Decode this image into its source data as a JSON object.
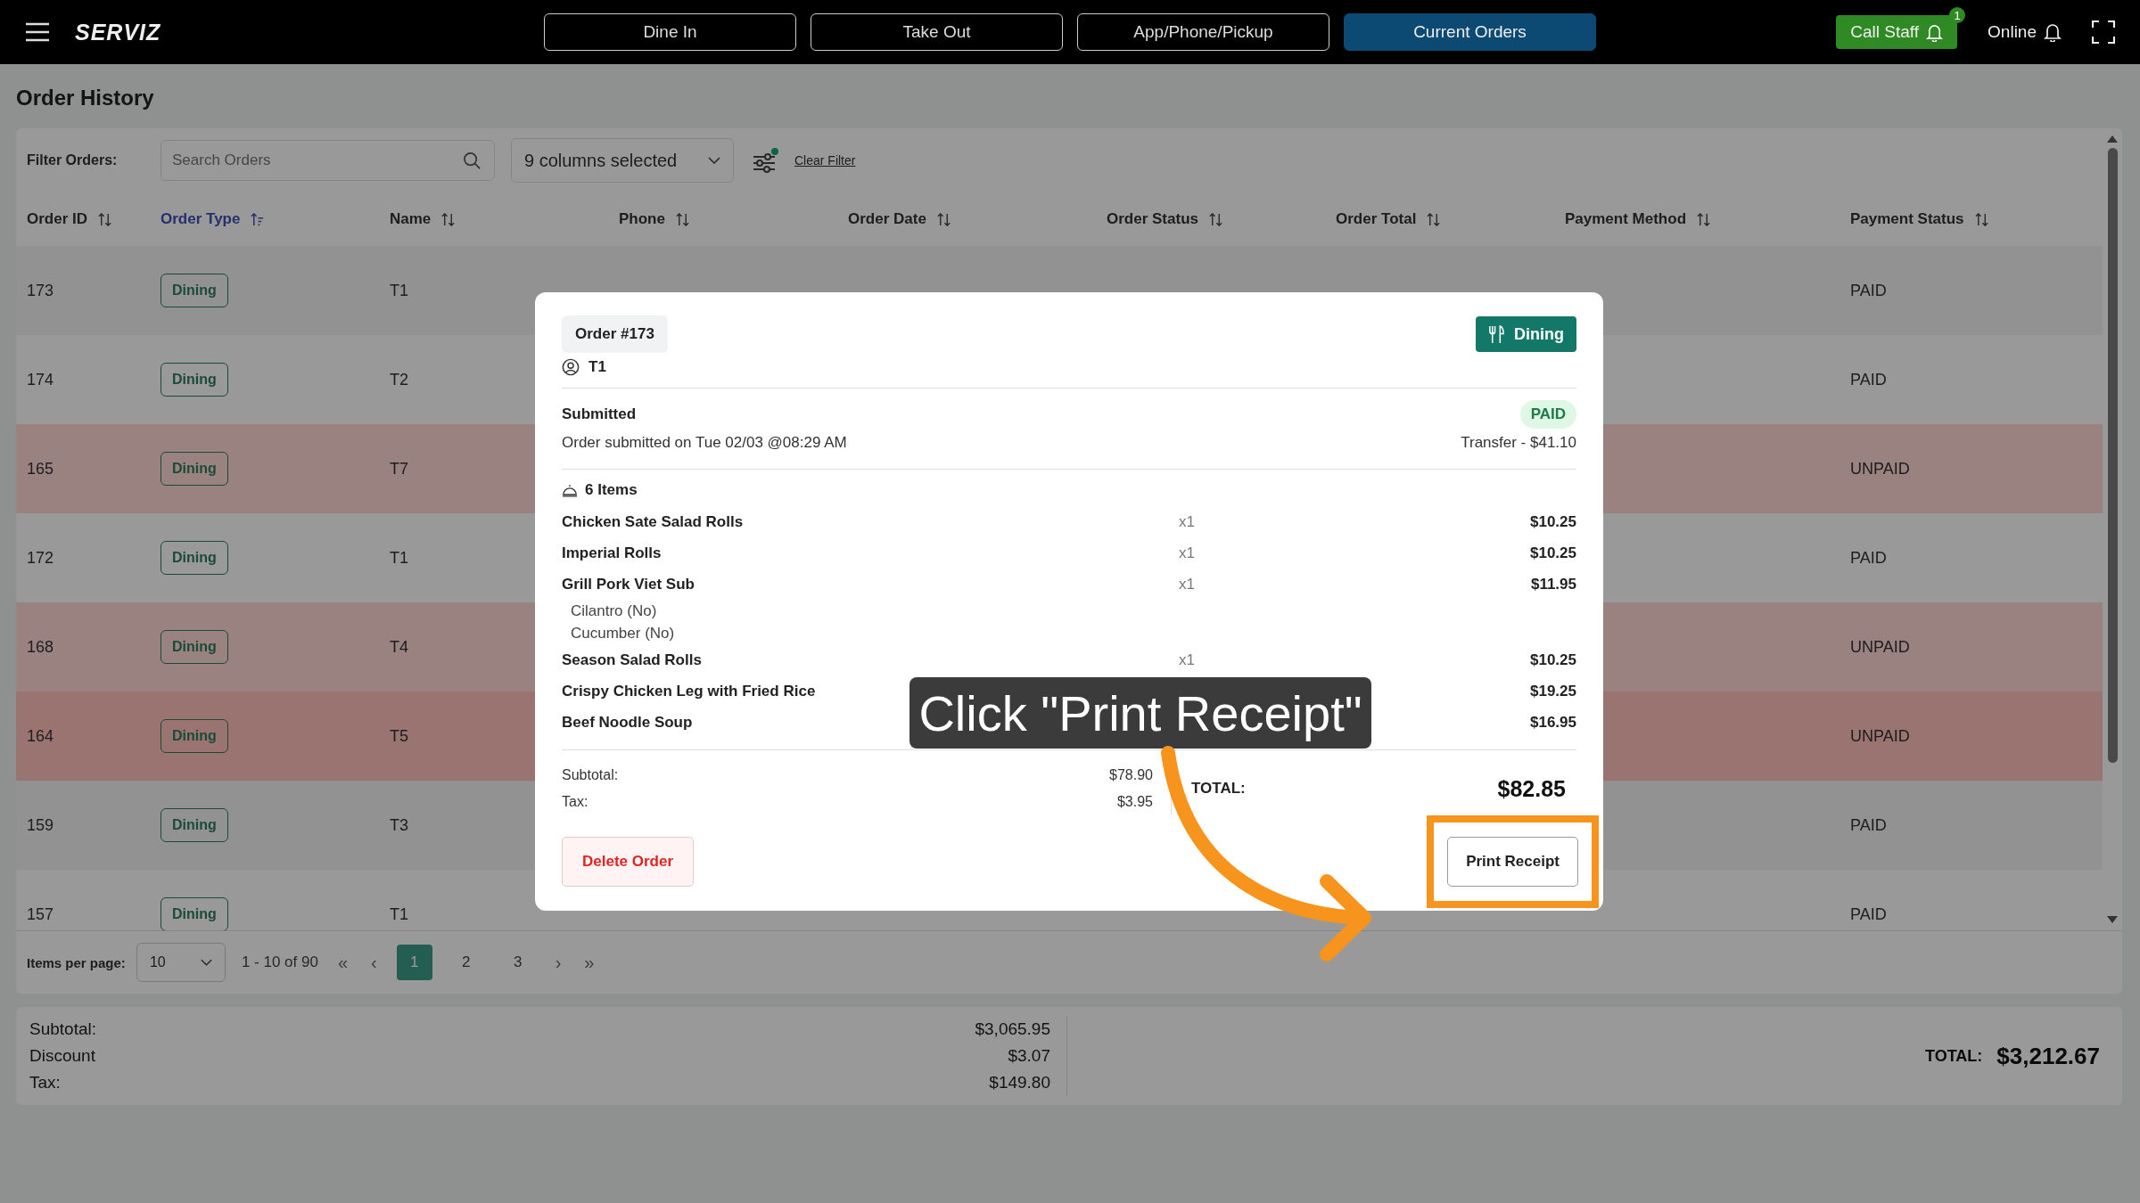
{
  "topbar": {
    "logo": "SERVIZ",
    "tabs": [
      {
        "label": "Dine In",
        "selected": false
      },
      {
        "label": "Take Out",
        "selected": false
      },
      {
        "label": "App/Phone/Pickup",
        "selected": false
      },
      {
        "label": "Current Orders",
        "selected": true
      }
    ],
    "call_staff": {
      "label": "Call Staff",
      "badge": "1"
    },
    "status": "Online"
  },
  "page": {
    "title": "Order History"
  },
  "filter": {
    "label": "Filter Orders:",
    "search": {
      "placeholder": "Search Orders"
    },
    "columns": "9 columns selected",
    "clear": "Clear Filter"
  },
  "table": {
    "columns": [
      {
        "label": "Order ID",
        "sorted": false
      },
      {
        "label": "Order Type",
        "sorted": true
      },
      {
        "label": "Name",
        "sorted": false
      },
      {
        "label": "Phone",
        "sorted": false
      },
      {
        "label": "Order Date",
        "sorted": false
      },
      {
        "label": "Order Status",
        "sorted": false
      },
      {
        "label": "Order Total",
        "sorted": false
      },
      {
        "label": "Payment Method",
        "sorted": false
      },
      {
        "label": "Payment Status",
        "sorted": false
      }
    ],
    "rows": [
      {
        "id": "173",
        "type": "Dining",
        "name": "T1",
        "payment": "PAID",
        "alert": false,
        "hovered": false
      },
      {
        "id": "174",
        "type": "Dining",
        "name": "T2",
        "payment": "PAID",
        "alert": false,
        "hovered": false
      },
      {
        "id": "165",
        "type": "Dining",
        "name": "T7",
        "payment": "UNPAID",
        "alert": true,
        "hovered": false
      },
      {
        "id": "172",
        "type": "Dining",
        "name": "T1",
        "payment": "PAID",
        "alert": false,
        "hovered": false
      },
      {
        "id": "168",
        "type": "Dining",
        "name": "T4",
        "payment": "UNPAID",
        "alert": true,
        "hovered": false
      },
      {
        "id": "164",
        "type": "Dining",
        "name": "T5",
        "payment": "UNPAID",
        "alert": true,
        "hovered": true
      },
      {
        "id": "159",
        "type": "Dining",
        "name": "T3",
        "payment": "PAID",
        "alert": false,
        "hovered": false
      },
      {
        "id": "157",
        "type": "Dining",
        "name": "T1",
        "payment": "PAID",
        "alert": false,
        "hovered": false
      }
    ]
  },
  "pagination": {
    "label": "Items per page:",
    "per_page": "10",
    "range": "1 - 10 of 90",
    "first": "«",
    "prev": "‹",
    "pages": [
      {
        "label": "1",
        "selected": true
      },
      {
        "label": "2",
        "selected": false
      },
      {
        "label": "3",
        "selected": false
      }
    ],
    "next": "›",
    "last": "»"
  },
  "totals": {
    "lines": [
      {
        "label": "Subtotal:",
        "value": "$3,065.95"
      },
      {
        "label": "Discount",
        "value": "$3.07"
      },
      {
        "label": "Tax:",
        "value": "$149.80"
      }
    ],
    "total_label": "TOTAL:",
    "total": "$3,212.67"
  },
  "modal": {
    "order": "Order #173",
    "type": "Dining",
    "customer": "T1",
    "state": "Submitted",
    "payment_badge": "PAID",
    "submitted": "Order submitted on Tue 02/03 @08:29 AM",
    "payment": "Transfer - $41.10",
    "count": "6 Items",
    "items": [
      {
        "name": "Chicken Sate Salad Rolls",
        "qty": "x1",
        "price": "$10.25"
      },
      {
        "name": "Imperial Rolls",
        "qty": "x1",
        "price": "$10.25"
      },
      {
        "name": "Grill Pork Viet Sub",
        "qty": "x1",
        "price": "$11.95",
        "modifiers": [
          "Cilantro (No)",
          "Cucumber (No)"
        ]
      },
      {
        "name": "Season Salad Rolls",
        "qty": "x1",
        "price": "$10.25"
      },
      {
        "name": "Crispy Chicken Leg with Fried Rice",
        "price": "$19.25"
      },
      {
        "name": "Beef Noodle Soup",
        "price": "$16.95"
      }
    ],
    "subtotal": {
      "label": "Subtotal:",
      "value": "$78.90"
    },
    "tax": {
      "label": "Tax:",
      "value": "$3.95"
    },
    "total_label": "TOTAL:",
    "total": "$82.85",
    "delete": "Delete Order",
    "print": "Print Receipt"
  },
  "callout": {
    "text": "Click \"Print Receipt\""
  }
}
